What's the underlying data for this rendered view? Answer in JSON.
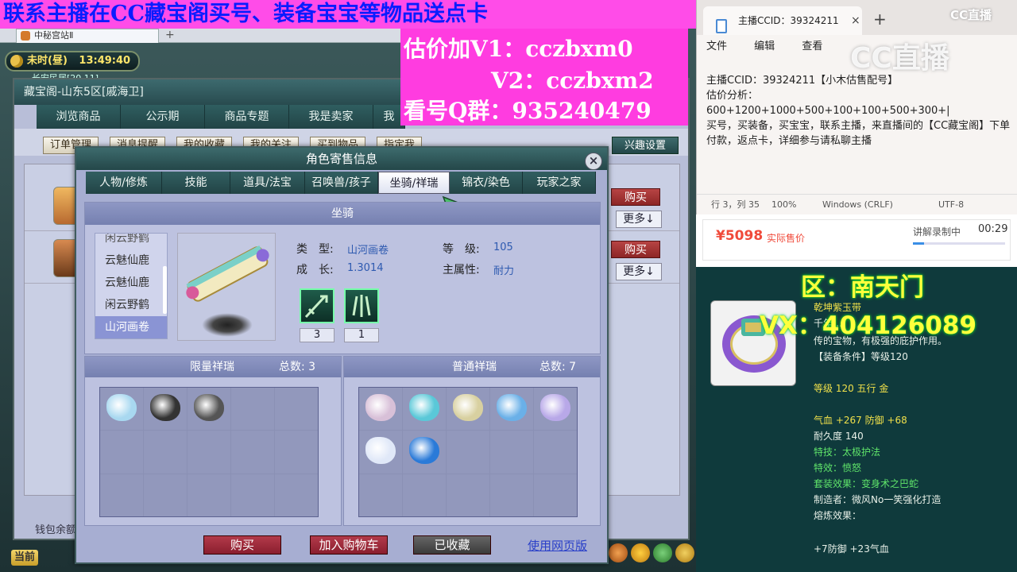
{
  "browser": {
    "tab_title": "中秘宫站Ⅱ"
  },
  "game": {
    "clock": {
      "period": "未时(昼)",
      "time": "13:49:40"
    },
    "location": "长安民居[20,11]",
    "window_title": "藏宝阁-山东5区[戚海卫]",
    "main_tabs": [
      "浏览商品",
      "公示期",
      "商品专题",
      "我是卖家",
      "我"
    ],
    "sub_buttons": [
      "订单管理",
      "消息提醒",
      "我的收藏",
      "我的关注",
      "买到物品",
      "指定我"
    ],
    "settings_button": "兴趣设置",
    "listing_buttons": {
      "buy": "购买",
      "more": "更多↓"
    },
    "wallet_label": "钱包余额",
    "bottom_label": "当前"
  },
  "dialog": {
    "title": "角色寄售信息",
    "tabs": [
      "人物/修炼",
      "技能",
      "道具/法宝",
      "召唤兽/孩子",
      "坐骑/祥瑞",
      "锦衣/染色",
      "玩家之家"
    ],
    "active_tab": "坐骑/祥瑞",
    "mount_header": "坐骑",
    "mount_list": [
      "闲云野鹤",
      "云魅仙鹿",
      "云魅仙鹿",
      "闲云野鹤",
      "山河画卷"
    ],
    "mount_selected": "山河画卷",
    "mount_info": {
      "type_label": "类　型:",
      "type_value": "山河画卷",
      "level_label": "等　级:",
      "level_value": "105",
      "growth_label": "成　长:",
      "growth_value": "1.3014",
      "attr_label": "主属性:",
      "attr_value": "耐力"
    },
    "skills": [
      {
        "icon": "mount-skill-icon-1",
        "count": "3"
      },
      {
        "icon": "mount-skill-icon-2",
        "count": "1"
      }
    ],
    "limited": {
      "title": "限量祥瑞",
      "total_label": "总数: 3",
      "pets": [
        "#a8d8f0",
        "#333333",
        "#555555"
      ]
    },
    "normal": {
      "title": "普通祥瑞",
      "total_label": "总数: 7",
      "pets": [
        "#d8c0d8",
        "#5ac8d8",
        "#d8d0a0",
        "#6ab0e8",
        "#b8a8e8",
        "#e0e8f8",
        "#2a7ad8"
      ]
    },
    "buttons": {
      "buy": "购买",
      "add_cart": "加入购物车",
      "collected": "已收藏",
      "web_link": "使用网页版"
    }
  },
  "overlays": {
    "banner": "联系主播在CC藏宝阁买号、装备宝宝等物品送点卡",
    "price_lines": [
      "估价加V1：cczbxm0",
      "V2：cczbxm2",
      "看号Q群：935240479"
    ],
    "region": "区：南天门",
    "vx": "VX：404126089"
  },
  "notepad": {
    "tab_title": "主播CCID：39324211",
    "menu": [
      "文件",
      "编辑",
      "查看"
    ],
    "lines": [
      "主播CCID：39324211【小木估售配号】",
      "估价分析：",
      "600+1200+1000+500+100+100+500+300+|",
      "买号，买装备，买宝宝，联系主播，来直播间的【CC藏宝阁】下单付款，返点卡，详细参与请私聊主播"
    ],
    "status": {
      "pos": "行 3，列 35",
      "zoom": "100%",
      "eol": "Windows (CRLF)",
      "enc": "UTF-8"
    }
  },
  "cc": {
    "logo": "CC直播",
    "logo_big": "CC直播"
  },
  "price_bar": {
    "price": "¥5098",
    "price_label": "实际售价",
    "rec_label": "讲解录制中",
    "rec_time": "00:29",
    "rec_progress": 0.12
  },
  "item": {
    "lines": [
      {
        "text": "乾坤紫玉带",
        "cls": "yellow"
      },
      {
        "text": "千年…",
        "cls": ""
      },
      {
        "text": "传的宝物，有极强的庇护作用。",
        "cls": ""
      },
      {
        "text": "【装备条件】等级120",
        "cls": ""
      },
      {
        "text": "等级 120 五行 金",
        "cls": "yellow"
      },
      {
        "text": "气血 +267 防御 +68",
        "cls": "yellow"
      },
      {
        "text": "耐久度 140",
        "cls": ""
      },
      {
        "text": "特技：太极护法",
        "cls": "green"
      },
      {
        "text": "特效：愤怒",
        "cls": "green"
      },
      {
        "text": "套装效果：变身术之巴蛇",
        "cls": "green"
      },
      {
        "text": "制造者：微风No一笑强化打造",
        "cls": ""
      },
      {
        "text": "熔炼效果：",
        "cls": ""
      },
      {
        "text": "+7防御 +23气血",
        "cls": ""
      }
    ]
  }
}
